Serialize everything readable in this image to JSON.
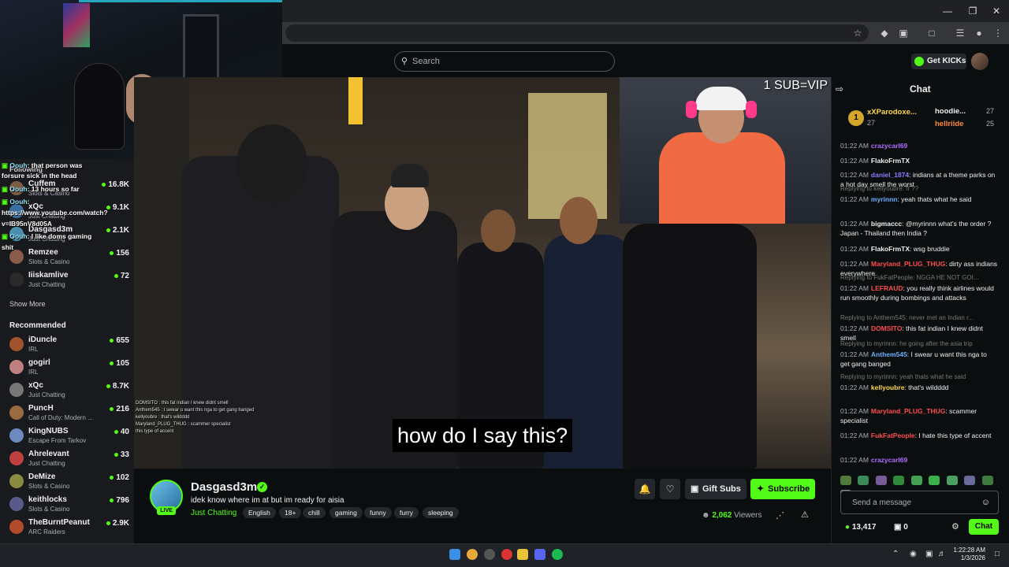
{
  "header": {
    "search_placeholder": "Search",
    "get_kicks": "Get KICKs"
  },
  "webcam_chat": [
    {
      "user": "Oouh",
      "text": ": that person was"
    },
    {
      "user": "",
      "text": "forsure sick in the head"
    },
    {
      "user": "Oouh",
      "text": ": 13 hours so far"
    },
    {
      "user": "Oouh",
      "text": ":"
    },
    {
      "user": "",
      "text": "https://www.youtube.com/watch?"
    },
    {
      "user": "",
      "text": "v=IB95nV8d05A"
    },
    {
      "user": "Oouh",
      "text": ": I like doms gaming"
    },
    {
      "user": "",
      "text": "shit"
    }
  ],
  "sidebar": {
    "following_heading": "Following",
    "following": [
      {
        "name": "Cuffem",
        "category": "Slots & Casino",
        "viewers": "16.8K"
      },
      {
        "name": "xQc",
        "category": "Just Chatting",
        "viewers": "9.1K"
      },
      {
        "name": "Dasgasd3m",
        "category": "Just Chatting",
        "viewers": "2.1K"
      },
      {
        "name": "Remzee",
        "category": "Slots & Casino",
        "viewers": "156"
      },
      {
        "name": "Iiiskamlive",
        "category": "Just Chatting",
        "viewers": "72"
      }
    ],
    "show_more": "Show More",
    "recommended_heading": "Recommended",
    "recommended": [
      {
        "name": "iDuncle",
        "category": "IRL",
        "viewers": "655"
      },
      {
        "name": "gogirl",
        "category": "IRL",
        "viewers": "105"
      },
      {
        "name": "xQc",
        "category": "Just Chatting",
        "viewers": "8.7K"
      },
      {
        "name": "PuncH",
        "category": "Call of Duty: Modern ...",
        "viewers": "216"
      },
      {
        "name": "KingNUBS",
        "category": "Escape From Tarkov",
        "viewers": "40"
      },
      {
        "name": "Ahrelevant",
        "category": "Just Chatting",
        "viewers": "33"
      },
      {
        "name": "DeMize",
        "category": "Slots & Casino",
        "viewers": "102"
      },
      {
        "name": "keithlocks",
        "category": "Slots & Casino",
        "viewers": "796"
      },
      {
        "name": "TheBurntPeanut",
        "category": "ARC Raiders",
        "viewers": "2.9K"
      }
    ]
  },
  "video": {
    "caption": "how do I say this?",
    "overlay_text": "1 SUB=VIP",
    "overlay_chat": [
      "DOMSITO : this fat indian I knew didnt smell",
      "Anthem545 : I swear u want this nga to get gang banged",
      "kellyoubre : that's wildddd",
      "Maryland_PLUG_THUG : scammer specialist",
      "this type of accent"
    ]
  },
  "stream": {
    "channel": "Dasgasd3m",
    "live": "LIVE",
    "title": "idek know where im at but im ready for aisia",
    "category": "Just Chatting",
    "tags": [
      "English",
      "18+",
      "chill",
      "gaming",
      "funny",
      "furry",
      "sleeping"
    ],
    "gift_subs": "Gift Subs",
    "subscribe": "Subscribe",
    "viewers_count": "2,062",
    "viewers_label": "Viewers"
  },
  "chat": {
    "title": "Chat",
    "gifters": [
      {
        "name": "xXParodoxe...",
        "count": "27"
      },
      {
        "name": "hoodie...",
        "count": "27"
      },
      {
        "name": "hellriide",
        "count": "25"
      }
    ],
    "messages": [
      {
        "time": "01:22 AM",
        "user": "crazycarl69",
        "color": "#b06cff",
        "text": ""
      },
      {
        "time": "01:22 AM",
        "user": "FlakoFrmTX",
        "color": "#efeff1",
        "text": ""
      },
      {
        "time": "01:22 AM",
        "user": "daniel_1874",
        "color": "#8c7bff",
        "text": ": indians at a theme parks on a hot day smell the worst"
      },
      {
        "reply": "Replying to kellyoubre: fr ??",
        "time": "01:22 AM",
        "user": "myrinnn",
        "color": "#6ab0ff",
        "text": ": yeah thats what he said"
      },
      {
        "time": "01:22 AM",
        "user": "bigmaccc",
        "color": "#efeff1",
        "text": ": @myrinnn what's the order ? Japan - Thailand then India ?"
      },
      {
        "time": "01:22 AM",
        "user": "FlakoFrmTX",
        "color": "#efeff1",
        "text": ": wsg bruddie"
      },
      {
        "time": "01:22 AM",
        "user": "Maryland_PLUG_THUG",
        "color": "#ff4d4d",
        "text": ": dirty ass indians everywhere"
      },
      {
        "reply": "Replying to FukFatPeople: NGGA HE NOT GOI...",
        "time": "01:22 AM",
        "user": "LEFRAUD",
        "color": "#ff4d4d",
        "text": ": you really think airlines would run smoothly during bombings and attacks"
      },
      {
        "reply": "Replying to Anthem545: never met an Indian r...",
        "time": "01:22 AM",
        "user": "DOMSITO",
        "color": "#ff4d4d",
        "text": ": this fat indian I knew didnt smell"
      },
      {
        "reply": "Replying to myrinnn: he going after the asia trip",
        "time": "01:22 AM",
        "user": "Anthem545",
        "color": "#6ab0ff",
        "text": ": I swear u want this nga to get gang banged"
      },
      {
        "reply": "Replying to myrinnn: yeah thats what he said",
        "time": "01:22 AM",
        "user": "kellyoubre",
        "color": "#ffd84d",
        "text": ": that's wildddd"
      },
      {
        "time": "01:22 AM",
        "user": "Maryland_PLUG_THUG",
        "color": "#ff4d4d",
        "text": ": scammer specialist"
      },
      {
        "time": "01:22 AM",
        "user": "FukFatPeople",
        "color": "#ff4d4d",
        "text": ": I hate this type of accent"
      },
      {
        "time": "01:22 AM",
        "user": "crazycarl69",
        "color": "#b06cff",
        "text": ""
      }
    ],
    "input_placeholder": "Send a message",
    "kicks": "13,417",
    "subs": "0",
    "send": "Chat"
  },
  "taskbar": {
    "time": "1:22:28 AM",
    "date": "1/3/2026"
  },
  "colors": {
    "kick_green": "#53fc18",
    "background": "#0b0e0f",
    "panel": "#24272c"
  }
}
